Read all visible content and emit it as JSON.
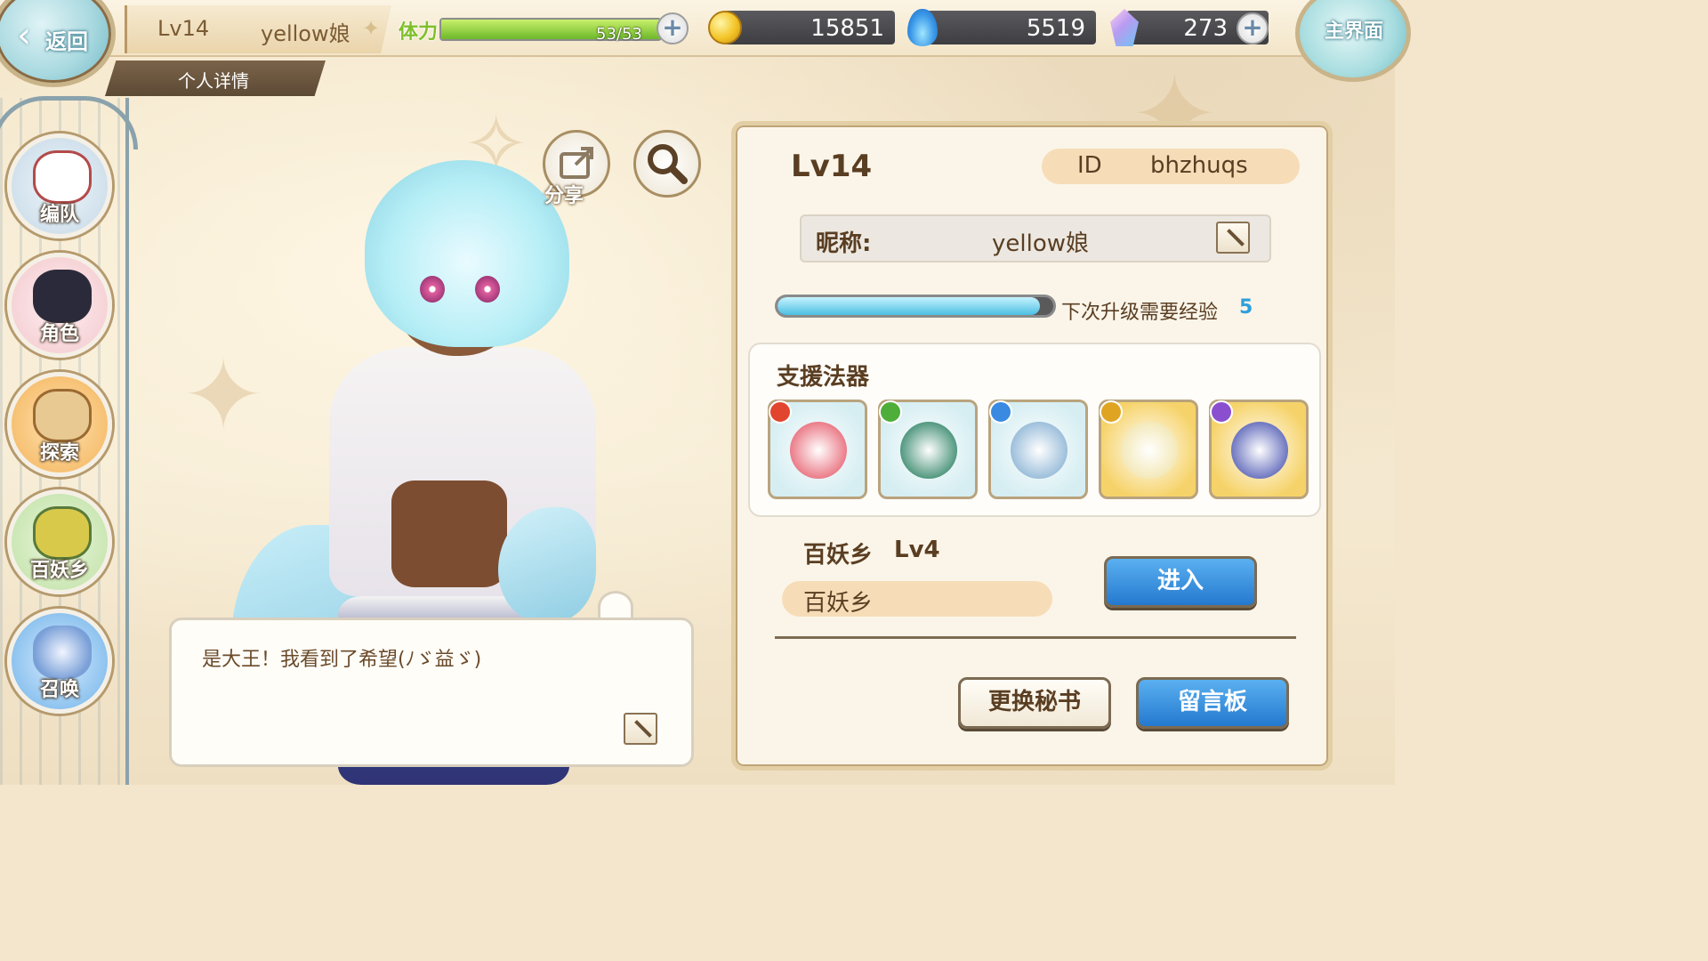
{
  "topbar": {
    "back_label": "返回",
    "player_level": "Lv14",
    "player_name": "yellow娘",
    "details_tab": "个人详情",
    "stamina_label": "体力",
    "stamina_value": "53/53",
    "stamina_fraction": 1.0,
    "gold": "15851",
    "spirit_fire": "5519",
    "crystal": "273",
    "home_label": "主界面"
  },
  "sidebar": {
    "items": [
      {
        "label": "编队",
        "color": "#c5d8e6"
      },
      {
        "label": "角色",
        "color": "#f2c7cc"
      },
      {
        "label": "探索",
        "color": "#f3b35a"
      },
      {
        "label": "百妖乡",
        "color": "#bfe0a5"
      },
      {
        "label": "召唤",
        "color": "#6fb2e8"
      }
    ]
  },
  "character": {
    "share_label": "分享",
    "dialogue": "是大王！我看到了希望(ﾉゞ益ゞ)"
  },
  "profile": {
    "level": "Lv14",
    "id_label": "ID",
    "id_value": "bhzhuqs",
    "nickname_label": "昵称:",
    "nickname_value": "yellow娘",
    "exp_label": "下次升级需要经验",
    "exp_value": "5",
    "exp_fraction": 0.95,
    "support_title": "支援法器",
    "artifacts": [
      {
        "name": "star-chain-artifact",
        "element_color": "#e2452d",
        "bg": "#d6eef2",
        "item_color": "#e86a78"
      },
      {
        "name": "jade-sword-artifact",
        "element_color": "#4fae3a",
        "bg": "#d6eef2",
        "item_color": "#3a8a6e"
      },
      {
        "name": "ice-dragon-artifact",
        "element_color": "#3a8ae2",
        "bg": "#d6eef2",
        "item_color": "#8fb6d6"
      },
      {
        "name": "golden-mirror-artifact",
        "element_color": "#e0a423",
        "bg": "#f6d36a",
        "item_color": "#f2e6b0"
      },
      {
        "name": "dark-beast-sword-artifact",
        "element_color": "#8a4fcf",
        "bg": "#f6d36a",
        "item_color": "#5a64b8"
      }
    ],
    "village_name": "百妖乡",
    "village_level": "Lv4",
    "village_pill": "百妖乡",
    "enter_button": "进入",
    "change_secretary_button": "更换秘书",
    "message_board_button": "留言板"
  }
}
